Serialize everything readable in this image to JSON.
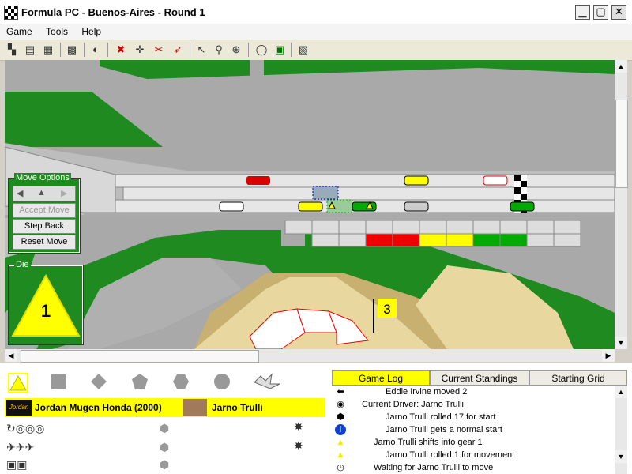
{
  "window": {
    "title": "Formula PC - Buenos-Aires - Round 1",
    "min": "▁",
    "max": "▢",
    "close": "✕"
  },
  "menu": [
    "Game",
    "Tools",
    "Help"
  ],
  "toolbar_icons": [
    "checkered-flag-icon",
    "open-icon",
    "save-icon",
    "grid-icon",
    "helmet-icon",
    "pin-icon",
    "target-icon",
    "tools-icon",
    "rocket-icon",
    "pointer-icon",
    "zoom-icon",
    "zoom-fit-icon",
    "comment-icon",
    "chat-icon",
    "settings-icon"
  ],
  "track": {
    "flag_number": "3"
  },
  "move_options": {
    "title": "Move Options",
    "accept": "Accept Move",
    "step_back": "Step Back",
    "reset": "Reset Move"
  },
  "die": {
    "title": "Die",
    "value": "1"
  },
  "team": {
    "logo": "Jordan",
    "name": "Jordan Mugen Honda (2000)",
    "driver": "Jarno Trulli"
  },
  "tabs": [
    "Game Log",
    "Current Standings",
    "Starting Grid"
  ],
  "log": [
    {
      "icon": "arrow-icon",
      "glyph": "⬅",
      "text": "Eddie Irvine moved 2",
      "indent": 68
    },
    {
      "icon": "helmet-icon",
      "glyph": "◉",
      "text": "Current Driver: Jarno Trulli",
      "indent": 38
    },
    {
      "icon": "hexagon-die-icon",
      "glyph": "⬢",
      "text": "Jarno Trulli rolled 17 for start",
      "indent": 68
    },
    {
      "icon": "info-icon",
      "glyph": "i",
      "text": "Jarno Trulli gets a normal start",
      "indent": 68
    },
    {
      "icon": "triangle-die-icon",
      "glyph": "▲",
      "text": "Jarno Trulli shifts into gear 1",
      "indent": 53
    },
    {
      "icon": "triangle-die-icon",
      "glyph": "▲",
      "text": "Jarno Trulli rolled 1 for movement",
      "indent": 68
    },
    {
      "icon": "clock-icon",
      "glyph": "◷",
      "text": "Waiting for Jarno Trulli to move",
      "indent": 53
    }
  ]
}
